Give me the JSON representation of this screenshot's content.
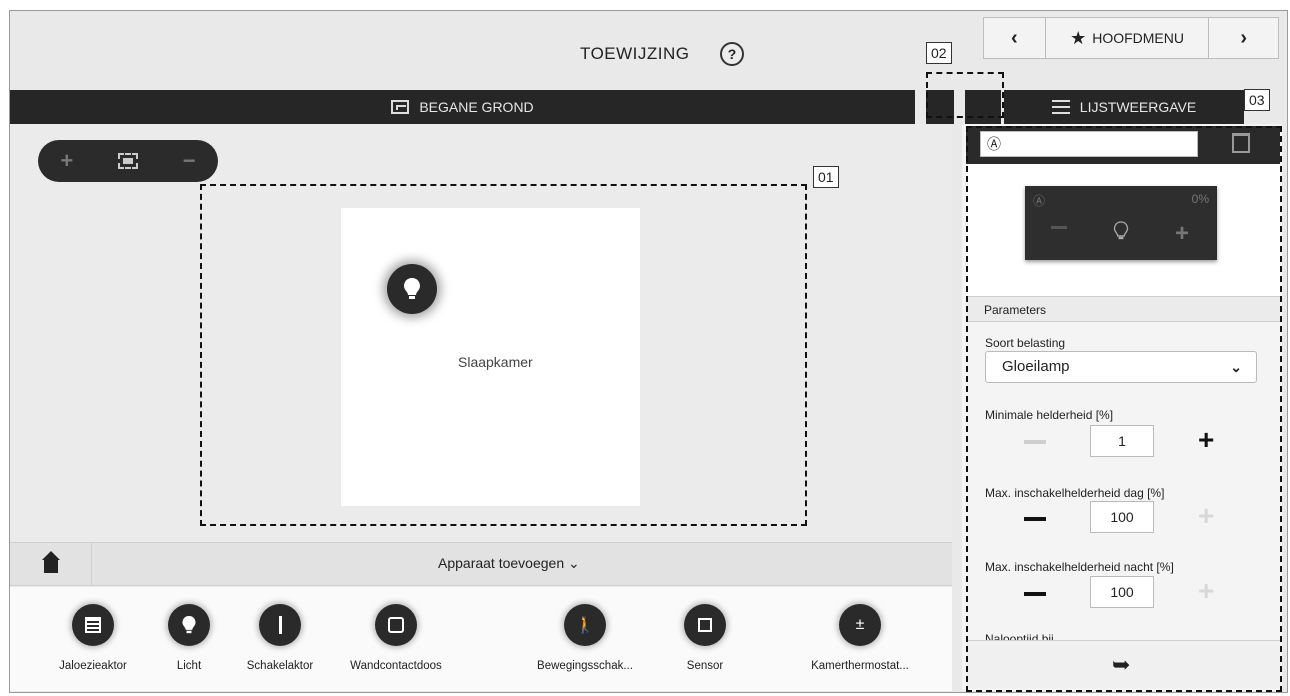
{
  "header": {
    "title": "TOEWIJZING",
    "help_icon": "?"
  },
  "nav": {
    "prev": "‹",
    "home_label": "HOOFDMENU",
    "next": "›"
  },
  "markers": {
    "m01": "01",
    "m02": "02",
    "m03": "03"
  },
  "floorbar": {
    "label": "BEGANE GROND"
  },
  "listview": {
    "label": "LIJSTWEERGAVE"
  },
  "zoom": {
    "in": "+",
    "out": "−"
  },
  "room": {
    "label": "Slaapkamer"
  },
  "app_bar": {
    "label": "Apparaat toevoegen ⌄"
  },
  "devices": [
    {
      "label": "Jaloezieaktor"
    },
    {
      "label": "Licht"
    },
    {
      "label": "Schakelaktor"
    },
    {
      "label": "Wandcontactdoos"
    },
    {
      "label": "Bewegingsschak..."
    },
    {
      "label": "Sensor"
    },
    {
      "label": "Kamerthermostat..."
    }
  ],
  "panel": {
    "name_value": "Ⓐ",
    "preview": {
      "label": "Ⓐ",
      "percent": "0%",
      "plus": "+"
    },
    "params_title": "Parameters",
    "load_type": {
      "label": "Soort belasting",
      "value": "Gloeilamp"
    },
    "min_brightness": {
      "label": "Minimale helderheid [%]",
      "value": "1"
    },
    "max_day": {
      "label": "Max. inschakelhelderheid dag [%]",
      "value": "100"
    },
    "max_night": {
      "label": "Max. inschakelhelderheid nacht [%]",
      "value": "100"
    },
    "cut_label": "Nalooptijd bij..."
  }
}
